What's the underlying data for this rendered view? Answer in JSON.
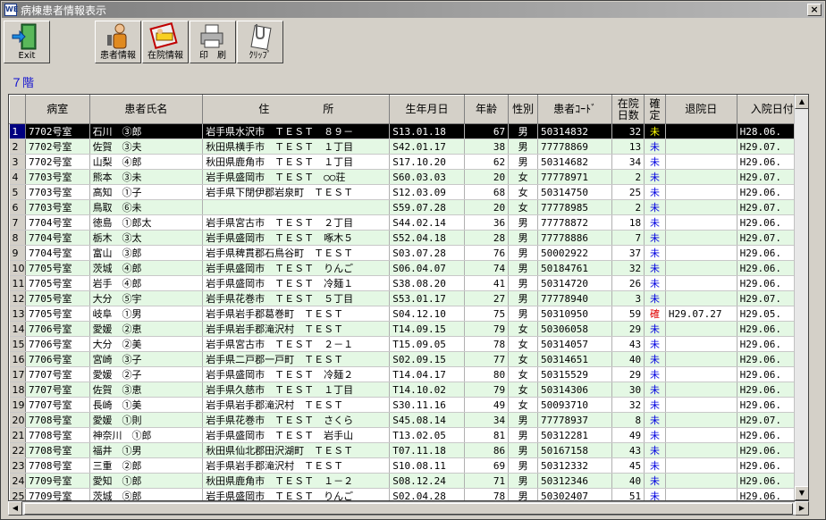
{
  "window": {
    "title": "病棟患者情報表示",
    "icon_text": "WE",
    "close_label": "×"
  },
  "toolbar": {
    "exit": "Exit",
    "patient": "患者情報",
    "inpatient": "在院情報",
    "print": "印　刷",
    "clip": "ｸﾘｯﾌﾟ"
  },
  "floor_label": "７階",
  "columns": [
    "病室",
    "患者氏名",
    "住　　　　　所",
    "生年月日",
    "年齢",
    "性別",
    "患者ｺｰﾄﾞ",
    "在院\n日数",
    "確\n定",
    "退院日",
    "入院日付"
  ],
  "rows": [
    [
      "1",
      "7702号室",
      "石川　③郎",
      "岩手県水沢市　ＴＥＳＴ　８９－",
      "S13.01.18",
      "67",
      "男",
      "50314832",
      "32",
      "未",
      "",
      "H28.06."
    ],
    [
      "2",
      "7702号室",
      "佐賀　③夫",
      "秋田県横手市　ＴＥＳＴ　１丁目",
      "S42.01.17",
      "38",
      "男",
      "77778869",
      "13",
      "未",
      "",
      "H29.07."
    ],
    [
      "3",
      "7702号室",
      "山梨　④郎",
      "秋田県鹿角市　ＴＥＳＴ　１丁目",
      "S17.10.20",
      "62",
      "男",
      "50314682",
      "34",
      "未",
      "",
      "H29.06."
    ],
    [
      "4",
      "7703号室",
      "熊本　③未",
      "岩手県盛岡市　ＴＥＳＴ　○○荘",
      "S60.03.03",
      "20",
      "女",
      "77778971",
      "2",
      "未",
      "",
      "H29.07."
    ],
    [
      "5",
      "7703号室",
      "高知　①子",
      "岩手県下閉伊郡岩泉町　ＴＥＳＴ",
      "S12.03.09",
      "68",
      "女",
      "50314750",
      "25",
      "未",
      "",
      "H29.06."
    ],
    [
      "6",
      "7703号室",
      "鳥取　⑥未",
      "",
      "S59.07.28",
      "20",
      "女",
      "77778985",
      "2",
      "未",
      "",
      "H29.07."
    ],
    [
      "7",
      "7704号室",
      "徳島　①郎太",
      "岩手県宮古市　ＴＥＳＴ　２丁目",
      "S44.02.14",
      "36",
      "男",
      "77778872",
      "18",
      "未",
      "",
      "H29.06."
    ],
    [
      "8",
      "7704号室",
      "栃木　③太",
      "岩手県盛岡市　ＴＥＳＴ　啄木５",
      "S52.04.18",
      "28",
      "男",
      "77778886",
      "7",
      "未",
      "",
      "H29.07."
    ],
    [
      "9",
      "7704号室",
      "富山　③郎",
      "岩手県稗貫郡石鳥谷町　ＴＥＳＴ",
      "S03.07.28",
      "76",
      "男",
      "50002922",
      "37",
      "未",
      "",
      "H29.06."
    ],
    [
      "10",
      "7705号室",
      "茨城　④郎",
      "岩手県盛岡市　ＴＥＳＴ　りんご",
      "S06.04.07",
      "74",
      "男",
      "50184761",
      "32",
      "未",
      "",
      "H29.06."
    ],
    [
      "11",
      "7705号室",
      "岩手　④郎",
      "岩手県盛岡市　ＴＥＳＴ　冷麺１",
      "S38.08.20",
      "41",
      "男",
      "50314720",
      "26",
      "未",
      "",
      "H29.06."
    ],
    [
      "12",
      "7705号室",
      "大分　⑤宇",
      "岩手県花巻市　ＴＥＳＴ　５丁目",
      "S53.01.17",
      "27",
      "男",
      "77778940",
      "3",
      "未",
      "",
      "H29.07."
    ],
    [
      "13",
      "7705号室",
      "岐阜　①男",
      "岩手県岩手郡葛巻町　ＴＥＳＴ",
      "S04.12.10",
      "75",
      "男",
      "50310950",
      "59",
      "確",
      "H29.07.27",
      "H29.05."
    ],
    [
      "14",
      "7706号室",
      "愛媛　②恵",
      "岩手県岩手郡滝沢村　ＴＥＳＴ",
      "T14.09.15",
      "79",
      "女",
      "50306058",
      "29",
      "未",
      "",
      "H29.06."
    ],
    [
      "15",
      "7706号室",
      "大分　②美",
      "岩手県宮古市　ＴＥＳＴ　２－１",
      "T15.09.05",
      "78",
      "女",
      "50314057",
      "43",
      "未",
      "",
      "H29.06."
    ],
    [
      "16",
      "7706号室",
      "宮崎　③子",
      "岩手県二戸郡一戸町　ＴＥＳＴ",
      "S02.09.15",
      "77",
      "女",
      "50314651",
      "40",
      "未",
      "",
      "H29.06."
    ],
    [
      "17",
      "7707号室",
      "愛媛　②子",
      "岩手県盛岡市　ＴＥＳＴ　冷麺２",
      "T14.04.17",
      "80",
      "女",
      "50315529",
      "29",
      "未",
      "",
      "H29.06."
    ],
    [
      "18",
      "7707号室",
      "佐賀　③恵",
      "岩手県久慈市　ＴＥＳＴ　１丁目",
      "T14.10.02",
      "79",
      "女",
      "50314306",
      "30",
      "未",
      "",
      "H29.06."
    ],
    [
      "19",
      "7707号室",
      "長崎　①美",
      "岩手県岩手郡滝沢村　ＴＥＳＴ",
      "S30.11.16",
      "49",
      "女",
      "50093710",
      "32",
      "未",
      "",
      "H29.06."
    ],
    [
      "20",
      "7708号室",
      "愛媛　①則",
      "岩手県花巻市　ＴＥＳＴ　さくら",
      "S45.08.14",
      "34",
      "男",
      "77778937",
      "8",
      "未",
      "",
      "H29.07."
    ],
    [
      "21",
      "7708号室",
      "神奈川　①郎",
      "岩手県盛岡市　ＴＥＳＴ　岩手山",
      "T13.02.05",
      "81",
      "男",
      "50312281",
      "49",
      "未",
      "",
      "H29.06."
    ],
    [
      "22",
      "7708号室",
      "福井　①男",
      "秋田県仙北郡田沢湖町　ＴＥＳＴ",
      "T07.11.18",
      "86",
      "男",
      "50167158",
      "43",
      "未",
      "",
      "H29.06."
    ],
    [
      "23",
      "7708号室",
      "三重　②郎",
      "岩手県岩手郡滝沢村　ＴＥＳＴ",
      "S10.08.11",
      "69",
      "男",
      "50312332",
      "45",
      "未",
      "",
      "H29.06."
    ],
    [
      "24",
      "7709号室",
      "愛知　①郎",
      "秋田県鹿角市　ＴＥＳＴ　１－２",
      "S08.12.24",
      "71",
      "男",
      "50312346",
      "40",
      "未",
      "",
      "H29.06."
    ],
    [
      "25",
      "7709号室",
      "茨城　⑤郎",
      "岩手県盛岡市　ＴＥＳＴ　りんご",
      "S02.04.28",
      "78",
      "男",
      "50302407",
      "51",
      "未",
      "",
      "H29.06."
    ]
  ],
  "colors": {
    "selected_row": "#000000",
    "even_row": "#e4f8e4",
    "status_unconfirmed": "#0000e0",
    "status_confirmed": "#e00000"
  }
}
